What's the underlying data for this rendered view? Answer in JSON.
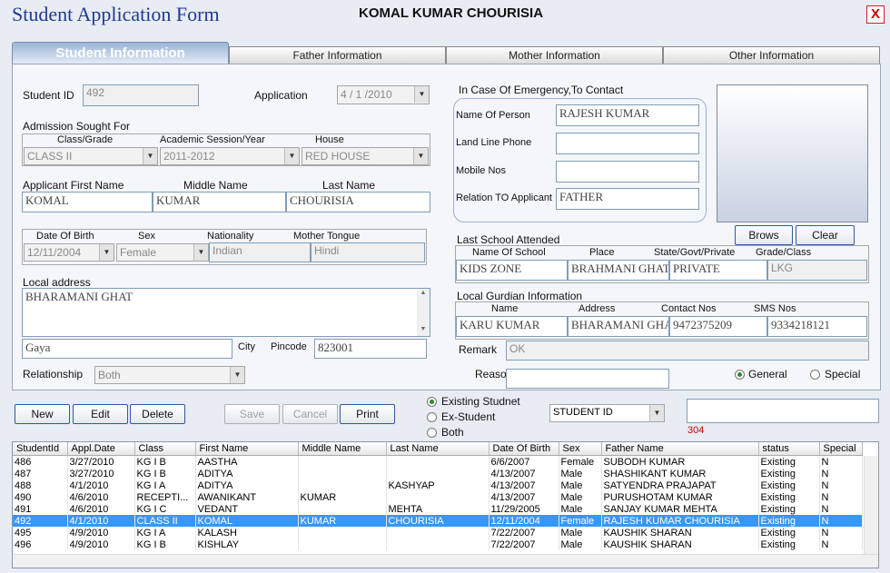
{
  "window": {
    "title": "Student Application Form",
    "student_name": "KOMAL KUMAR CHOURISIA",
    "close": "X"
  },
  "tabs": [
    "Student Information",
    "Father Information",
    "Mother Information",
    "Other Information"
  ],
  "student": {
    "id_label": "Student ID",
    "id_value": "492",
    "application_label": "Application",
    "application_date": "4 / 1 /2010",
    "admission_label": "Admission Sought For",
    "class_label": "Class/Grade",
    "class_value": "CLASS II",
    "session_label": "Academic Session/Year",
    "session_value": "2011-2012",
    "house_label": "House",
    "house_value": "RED HOUSE",
    "applicant_label": "Applicant  First Name",
    "first_name": "KOMAL",
    "middle_label": "Middle Name",
    "middle_name": "KUMAR",
    "last_label": "Last Name",
    "last_name": "CHOURISIA",
    "dob_label": "Date Of Birth",
    "dob_value": "12/11/2004",
    "sex_label": "Sex",
    "sex_value": "Female",
    "nationality_label": "Nationality",
    "nationality_value": "Indian",
    "tongue_label": "Mother Tongue",
    "tongue_value": "Hindi",
    "address_label": "Local address",
    "address_value": "BHARAMANI GHAT",
    "city_value": "Gaya",
    "city_label": "City",
    "pincode_label": "Pincode",
    "pincode_value": "823001",
    "relationship_label": "Relationship",
    "relationship_value": "Both"
  },
  "emergency": {
    "heading": "In Case Of Emergency,To Contact",
    "person_label": "Name Of Person",
    "person_value": "RAJESH KUMAR",
    "landline_label": "Land Line Phone",
    "landline_value": "",
    "mobile_label": "Mobile Nos",
    "mobile_value": "",
    "relation_label": "Relation TO Applicant",
    "relation_value": "FATHER"
  },
  "photo": {
    "label": "Photo",
    "browse": "Brows",
    "clear": "Clear"
  },
  "last_school": {
    "heading": "Last School Attended",
    "headers": [
      "Name Of School",
      "Place",
      "State/Govt/Private",
      "Grade/Class"
    ],
    "values": [
      "KIDS ZONE",
      "BRAHMANI GHAT",
      "PRIVATE",
      "LKG"
    ]
  },
  "guardian": {
    "heading": "Local Gurdian Information",
    "headers": [
      "Name",
      "Address",
      "Contact Nos",
      "SMS Nos"
    ],
    "values": [
      "KARU KUMAR",
      "BHARAMANI GHAT",
      "9472375209",
      "9334218121"
    ]
  },
  "remark": {
    "label": "Remark",
    "value": "OK"
  },
  "reason": {
    "label": "Reaso",
    "value": ""
  },
  "category": {
    "general": "General",
    "special": "Special",
    "selected": "General"
  },
  "toolbar": {
    "new": "New",
    "edit": "Edit",
    "delete": "Delete",
    "save": "Save",
    "cancel": "Cancel",
    "print": "Print"
  },
  "filter": {
    "options": [
      "Existing Studnet",
      "Ex-Student",
      "Both"
    ],
    "selected": "Existing Studnet",
    "search_by": "STUDENT ID",
    "search_value": "",
    "count": "304"
  },
  "grid": {
    "columns": [
      "StudentId",
      "Appl.Date",
      "Class",
      "First Name",
      "Middle Name",
      "Last Name",
      "Date Of Birth",
      "Sex",
      "Father Name",
      "status",
      "Special"
    ],
    "rows": [
      [
        "486",
        "3/27/2010",
        "KG I B",
        "AASTHA",
        "",
        "",
        "6/6/2007",
        "Female",
        "SUBODH KUMAR",
        "Existing",
        "N"
      ],
      [
        "487",
        "3/27/2010",
        "KG I B",
        "ADITYA",
        "",
        "",
        "4/13/2007",
        "Male",
        "SHASHIKANT KUMAR",
        "Existing",
        "N"
      ],
      [
        "488",
        "4/1/2010",
        "KG I A",
        "ADITYA",
        "",
        "KASHYAP",
        "4/13/2007",
        "Male",
        "SATYENDRA PRAJAPAT",
        "Existing",
        "N"
      ],
      [
        "490",
        "4/6/2010",
        "RECEPTI...",
        "AWANIKANT",
        "KUMAR",
        "",
        "4/13/2007",
        "Male",
        "PURUSHOTAM KUMAR",
        "Existing",
        "N"
      ],
      [
        "491",
        "4/6/2010",
        "KG I C",
        "VEDANT",
        "",
        "MEHTA",
        "11/29/2005",
        "Male",
        "SANJAY KUMAR MEHTA",
        "Existing",
        "N"
      ],
      [
        "492",
        "4/1/2010",
        "CLASS II",
        "KOMAL",
        "KUMAR",
        "CHOURISIA",
        "12/11/2004",
        "Female",
        "RAJESH KUMAR CHOURISIA",
        "Existing",
        "N"
      ],
      [
        "495",
        "4/9/2010",
        "KG I A",
        "KALASH",
        "",
        "",
        "7/22/2007",
        "Male",
        "KAUSHIK SHARAN",
        "Existing",
        "N"
      ],
      [
        "496",
        "4/9/2010",
        "KG I B",
        "KISHLAY",
        "",
        "",
        "7/22/2007",
        "Male",
        "KAUSHIK SHARAN",
        "Existing",
        "N"
      ]
    ],
    "selected_row": 5
  }
}
